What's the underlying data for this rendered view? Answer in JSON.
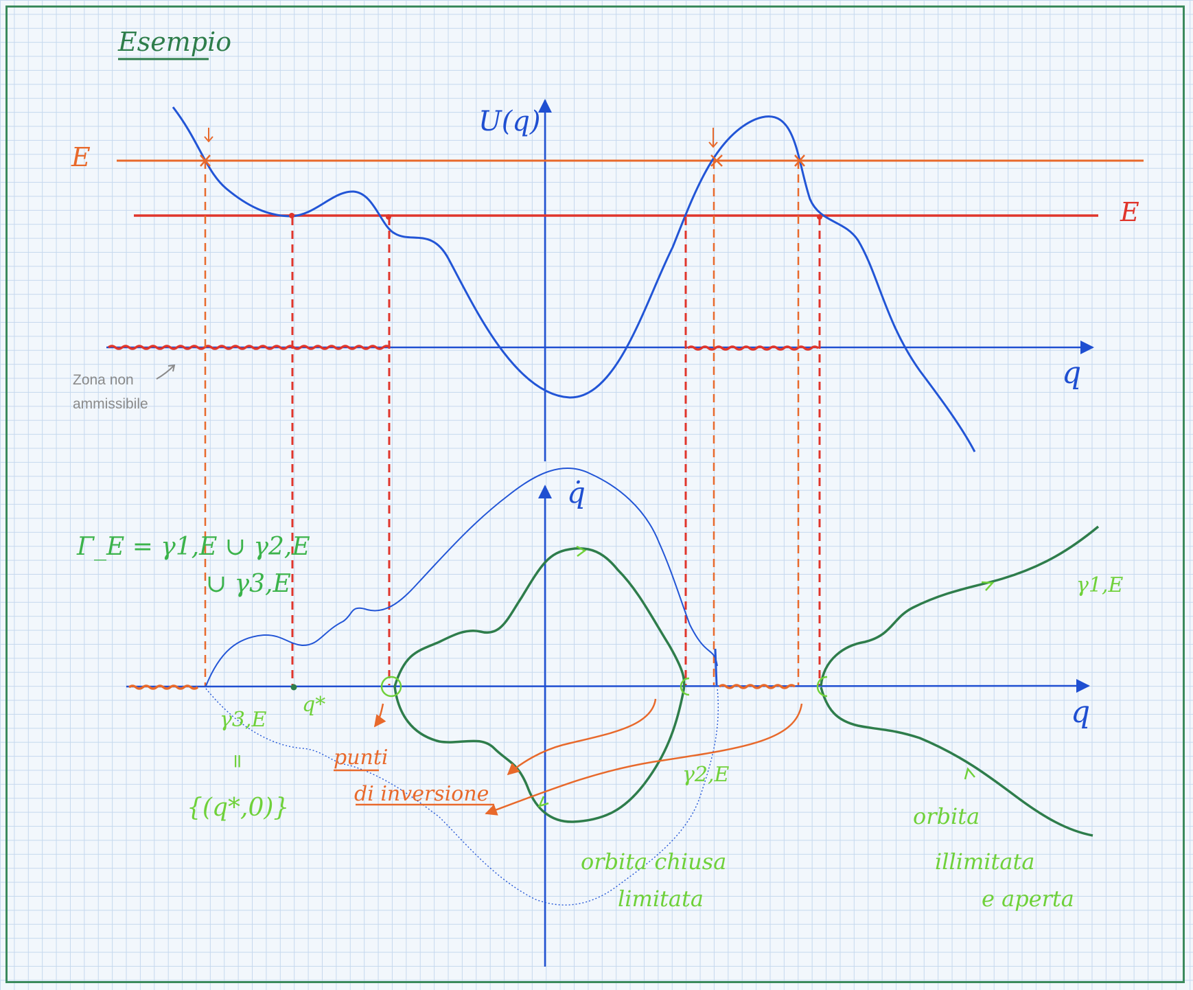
{
  "title": "Esempio",
  "top_plot": {
    "y_axis_label": "U(q)",
    "x_axis_label": "q",
    "energy_high_label": "E",
    "energy_low_label": "E",
    "forbidden_zone_note_line1": "Zona non",
    "forbidden_zone_note_line2": "ammissibile"
  },
  "phase_plot": {
    "y_axis_label": "q̇",
    "x_axis_label": "q",
    "gamma_union_line1": "Γ_E = γ1,E ∪ γ2,E",
    "gamma_union_line2": "∪ γ3,E",
    "equilibrium_label": "q*",
    "gamma3_label": "γ3,E",
    "gamma3_equals": "=",
    "gamma3_set": "{(q*,0)}",
    "inversion_line1": "punti",
    "inversion_line2": "di inversione",
    "gamma2_label": "γ2,E",
    "gamma1_label": "γ1,E",
    "closed_orbit_line1": "orbita chiusa",
    "closed_orbit_line2": "limitata",
    "open_orbit_line1": "orbita",
    "open_orbit_line2": "illimitata",
    "open_orbit_line3": "e aperta"
  },
  "colors": {
    "axis": "#1f4fd1",
    "curve": "#2255d6",
    "energy_high": "#e8692b",
    "energy_low": "#e0352b",
    "orbit": "#2e7d4b",
    "annotation": "#6fd13a",
    "title": "#2e7d4b",
    "note": "#8a8a8a"
  }
}
